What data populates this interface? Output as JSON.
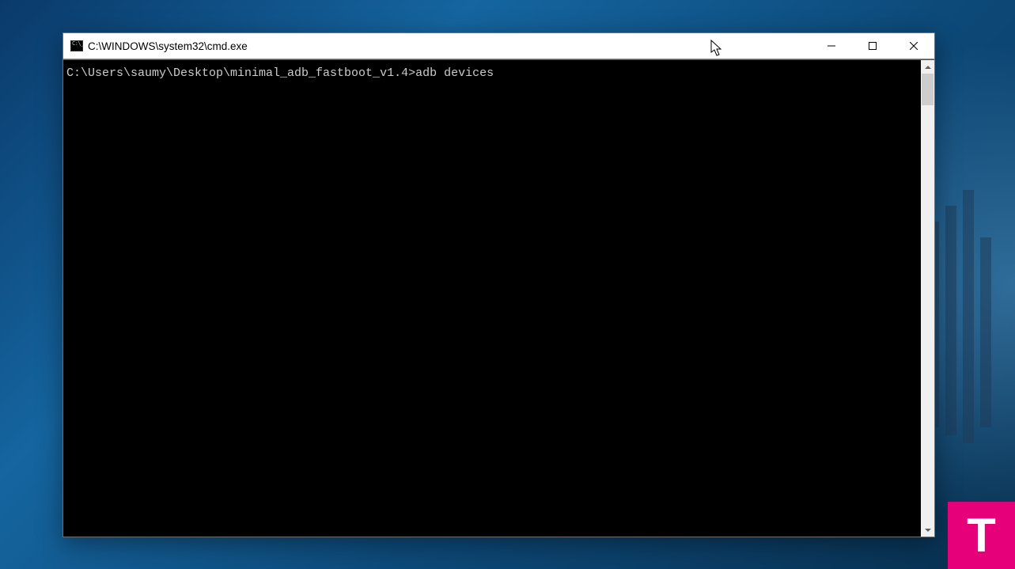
{
  "window": {
    "title": "C:\\WINDOWS\\system32\\cmd.exe"
  },
  "terminal": {
    "prompt": "C:\\Users\\saumy\\Desktop\\minimal_adb_fastboot_v1.4>",
    "command": "adb devices"
  },
  "watermark": {
    "letter": "T"
  }
}
